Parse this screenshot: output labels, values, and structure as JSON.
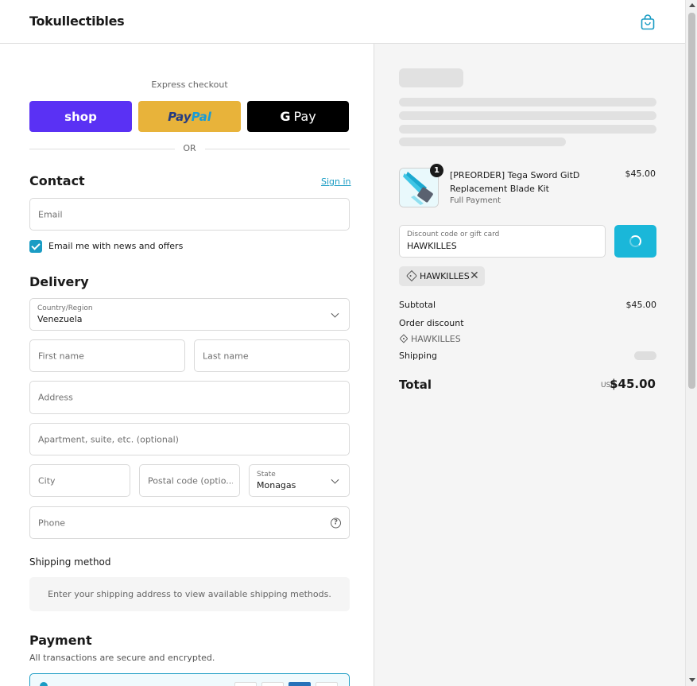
{
  "header": {
    "brand": "Tokullectibles",
    "cart_icon": "shopping-bag-icon"
  },
  "express": {
    "label": "Express checkout",
    "shop_label": "shop",
    "paypal_part1": "Pay",
    "paypal_part2": "Pal",
    "gpay_g": "G",
    "gpay_label": "Pay",
    "or": "OR"
  },
  "contact": {
    "title": "Contact",
    "sign_in": "Sign in",
    "email_placeholder": "Email",
    "newsletter_label": "Email me with news and offers",
    "newsletter_checked": true
  },
  "delivery": {
    "title": "Delivery",
    "country_label": "Country/Region",
    "country_value": "Venezuela",
    "first_name": "First name",
    "last_name": "Last name",
    "address": "Address",
    "apartment": "Apartment, suite, etc. (optional)",
    "city": "City",
    "postal": "Postal code (optio...",
    "state_label": "State",
    "state_value": "Monagas",
    "phone": "Phone"
  },
  "shipping_method": {
    "title": "Shipping method",
    "message": "Enter your shipping address to view available shipping methods."
  },
  "payment": {
    "title": "Payment",
    "subtitle": "All transactions are secure and encrypted."
  },
  "summary": {
    "item": {
      "quantity": "1",
      "name": "[PREORDER] Tega Sword GitD Replacement Blade Kit",
      "variant": "Full Payment",
      "price": "$45.00"
    },
    "discount_label": "Discount code or gift card",
    "discount_value": "HAWKILLES",
    "applied_code": "HAWKILLES",
    "subtotal_label": "Subtotal",
    "subtotal_value": "$45.00",
    "order_discount_label": "Order discount",
    "order_discount_code": "HAWKILLES",
    "shipping_label": "Shipping",
    "total_label": "Total",
    "currency": "USD",
    "total_value": "$45.00"
  },
  "colors": {
    "accent": "#1a9cc4",
    "apply_button": "#1ab7d9",
    "shop_pay": "#5a31f4",
    "paypal": "#e8b33a"
  }
}
